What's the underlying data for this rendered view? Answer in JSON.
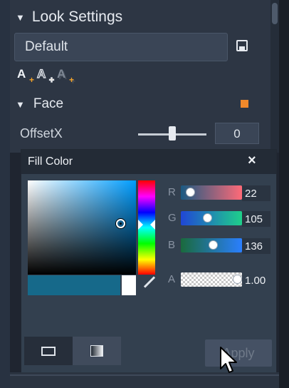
{
  "look_settings": {
    "section_title": "Look Settings",
    "preset_value": "Default",
    "style_icons": [
      "A",
      "A",
      "A"
    ],
    "face": {
      "label": "Face",
      "color": "#f0892b"
    },
    "offset": {
      "label": "OffsetX",
      "value": "0",
      "slider_position": 0.5
    }
  },
  "fill_color_dialog": {
    "title": "Fill Color",
    "close_glyph": "×",
    "current_color": "#16698a",
    "previous_color": "#ffffff",
    "channels": [
      {
        "label": "R",
        "value": "22",
        "fraction": 0.086,
        "gradient": [
          "#1a5a82",
          "#ff6a78"
        ]
      },
      {
        "label": "G",
        "value": "105",
        "fraction": 0.41,
        "gradient": [
          "#2046d6",
          "#1fd08a"
        ]
      },
      {
        "label": "B",
        "value": "136",
        "fraction": 0.53,
        "gradient": [
          "#1a6a3c",
          "#2a7fff"
        ]
      }
    ],
    "alpha": {
      "label": "A",
      "value": "1.00",
      "fraction": 1.0
    },
    "apply_label": "Apply"
  }
}
